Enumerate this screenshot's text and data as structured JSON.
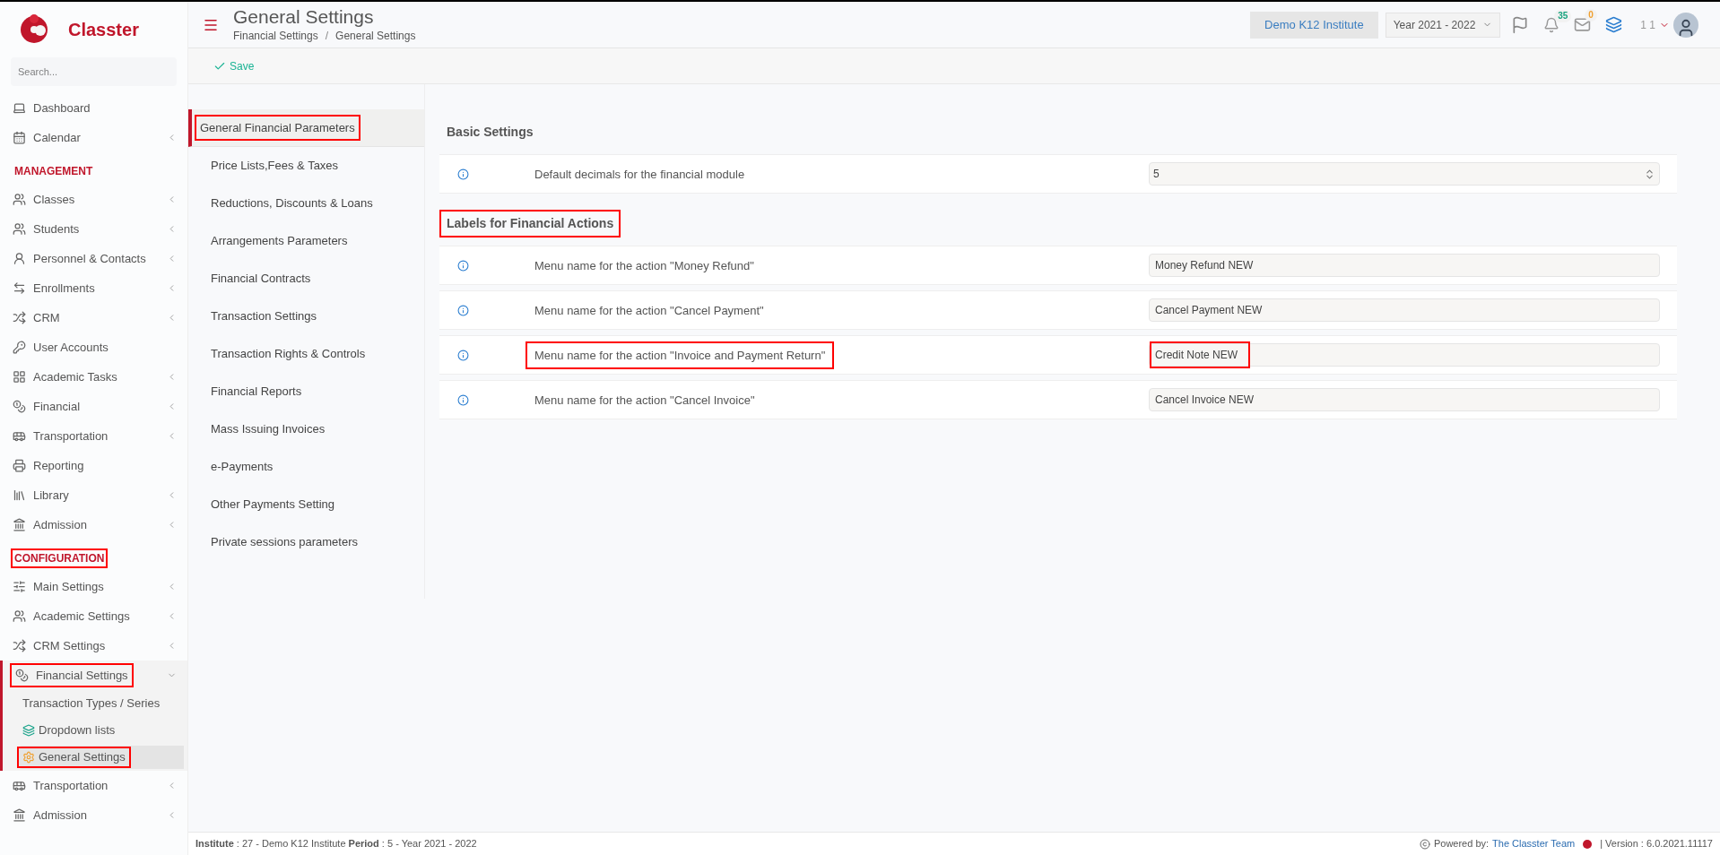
{
  "brand": {
    "name": "Classter"
  },
  "sidebar": {
    "search": {
      "placeholder": "Search..."
    },
    "items": [
      {
        "kind": "item",
        "label": "Dashboard"
      },
      {
        "kind": "item",
        "label": "Calendar",
        "expanded": false
      },
      {
        "kind": "section",
        "label": "MANAGEMENT",
        "highlighted": false
      },
      {
        "kind": "item",
        "label": "Classes",
        "expanded": false
      },
      {
        "kind": "item",
        "label": "Students",
        "expanded": false
      },
      {
        "kind": "item",
        "label": "Personnel & Contacts",
        "expanded": false
      },
      {
        "kind": "item",
        "label": "Enrollments",
        "expanded": false
      },
      {
        "kind": "item",
        "label": "CRM",
        "expanded": false
      },
      {
        "kind": "item",
        "label": "User Accounts"
      },
      {
        "kind": "item",
        "label": "Academic Tasks",
        "expanded": false
      },
      {
        "kind": "item",
        "label": "Financial",
        "expanded": false
      },
      {
        "kind": "item",
        "label": "Transportation",
        "expanded": false
      },
      {
        "kind": "item",
        "label": "Reporting"
      },
      {
        "kind": "item",
        "label": "Library",
        "expanded": false
      },
      {
        "kind": "item",
        "label": "Admission",
        "expanded": false
      },
      {
        "kind": "section",
        "label": "CONFIGURATION",
        "highlighted": true
      },
      {
        "kind": "item",
        "label": "Main Settings",
        "expanded": false
      },
      {
        "kind": "item",
        "label": "Academic Settings",
        "expanded": false
      },
      {
        "kind": "item",
        "label": "CRM Settings",
        "expanded": false
      },
      {
        "kind": "item",
        "label": "Financial Settings",
        "expanded": true,
        "highlighted": true,
        "children": [
          {
            "label": "Transaction Types / Series",
            "selected": false,
            "highlighted": false
          },
          {
            "label": "Dropdown lists",
            "selected": false,
            "highlighted": false
          },
          {
            "label": "General Settings",
            "selected": true,
            "highlighted": true
          }
        ]
      },
      {
        "kind": "item",
        "label": "Transportation",
        "expanded": false
      },
      {
        "kind": "item",
        "label": "Admission",
        "expanded": false
      }
    ]
  },
  "header": {
    "title": "General Settings",
    "breadcrumb": [
      "Financial Settings",
      "General Settings"
    ],
    "separator": "/",
    "institute": "Demo K12 Institute",
    "year": "Year 2021 - 2022",
    "notifications": "35",
    "messages": "0",
    "user": "1 1"
  },
  "toolbar": {
    "save": "Save"
  },
  "settings_nav": [
    {
      "label": "General Financial Parameters",
      "selected": true,
      "highlighted": true
    },
    {
      "label": "Price Lists,Fees & Taxes",
      "selected": false,
      "highlighted": false
    },
    {
      "label": "Reductions, Discounts & Loans",
      "selected": false,
      "highlighted": false
    },
    {
      "label": "Arrangements Parameters",
      "selected": false,
      "highlighted": false
    },
    {
      "label": "Financial Contracts",
      "selected": false,
      "highlighted": false
    },
    {
      "label": "Transaction Settings",
      "selected": false,
      "highlighted": false
    },
    {
      "label": "Transaction Rights & Controls",
      "selected": false,
      "highlighted": false
    },
    {
      "label": "Financial Reports",
      "selected": false,
      "highlighted": false
    },
    {
      "label": "Mass Issuing Invoices",
      "selected": false,
      "highlighted": false
    },
    {
      "label": "e-Payments",
      "selected": false,
      "highlighted": false
    },
    {
      "label": "Other Payments Setting",
      "selected": false,
      "highlighted": false
    },
    {
      "label": "Private sessions parameters",
      "selected": false,
      "highlighted": false
    }
  ],
  "sections": [
    {
      "title": "Basic Settings",
      "highlighted": false,
      "rows": [
        {
          "label": "Default decimals for the financial module",
          "kind": "number",
          "value": "5",
          "label_highlighted": false
        }
      ]
    },
    {
      "title": "Labels for Financial Actions",
      "highlighted": true,
      "rows": [
        {
          "label": "Menu name for the action \"Money Refund\"",
          "kind": "text",
          "value": "Money Refund NEW",
          "label_highlighted": false,
          "value_highlighted": false
        },
        {
          "label": "Menu name for the action \"Cancel Payment\"",
          "kind": "text",
          "value": "Cancel Payment NEW",
          "label_highlighted": false,
          "value_highlighted": false
        },
        {
          "label": "Menu name for the action \"Invoice and Payment Return\"",
          "kind": "text",
          "value": "Credit Note NEW",
          "label_highlighted": true,
          "value_highlighted": true
        },
        {
          "label": "Menu name for the action \"Cancel Invoice\"",
          "kind": "text",
          "value": "Cancel Invoice NEW",
          "label_highlighted": false,
          "value_highlighted": false
        }
      ]
    }
  ],
  "footer": {
    "info": "**Institute** : 27 - Demo K12 Institute **Period** : 5 - Year 2021 - 2022",
    "powered": "Powered by:",
    "team": "The Classter Team",
    "version": "| Version : 6.0.2021.11117"
  }
}
